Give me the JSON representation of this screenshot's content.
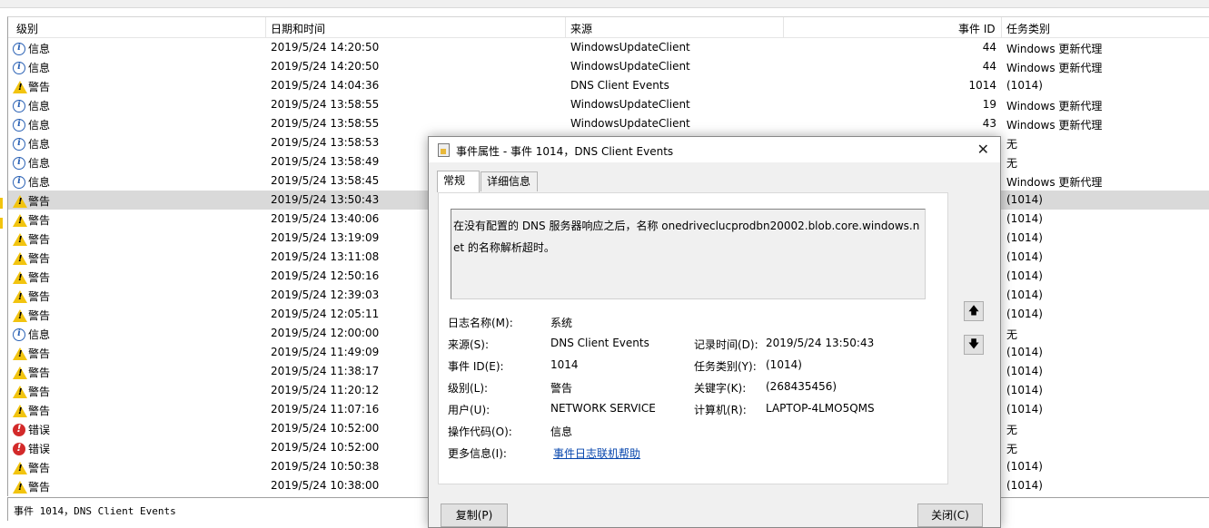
{
  "columns": {
    "level": "级别",
    "date": "日期和时间",
    "source": "来源",
    "event_id": "事件 ID",
    "task": "任务类别"
  },
  "rows": [
    {
      "icon": "info-icon",
      "level": "信息",
      "date": "2019/5/24 14:20:50",
      "source": "WindowsUpdateClient",
      "id": "44",
      "task": "Windows 更新代理"
    },
    {
      "icon": "info-icon",
      "level": "信息",
      "date": "2019/5/24 14:20:50",
      "source": "WindowsUpdateClient",
      "id": "44",
      "task": "Windows 更新代理"
    },
    {
      "icon": "warning-icon",
      "level": "警告",
      "date": "2019/5/24 14:04:36",
      "source": "DNS Client Events",
      "id": "1014",
      "task": "(1014)"
    },
    {
      "icon": "info-icon",
      "level": "信息",
      "date": "2019/5/24 13:58:55",
      "source": "WindowsUpdateClient",
      "id": "19",
      "task": "Windows 更新代理"
    },
    {
      "icon": "info-icon",
      "level": "信息",
      "date": "2019/5/24 13:58:55",
      "source": "WindowsUpdateClient",
      "id": "43",
      "task": "Windows 更新代理"
    },
    {
      "icon": "info-icon",
      "level": "信息",
      "date": "2019/5/24 13:58:53",
      "source": "",
      "id": "",
      "task": "无"
    },
    {
      "icon": "info-icon",
      "level": "信息",
      "date": "2019/5/24 13:58:49",
      "source": "",
      "id": "",
      "task": "无"
    },
    {
      "icon": "info-icon",
      "level": "信息",
      "date": "2019/5/24 13:58:45",
      "source": "",
      "id": "",
      "task": "Windows 更新代理"
    },
    {
      "icon": "warning-icon",
      "level": "警告",
      "date": "2019/5/24 13:50:43",
      "source": "",
      "id": "",
      "task": "(1014)",
      "selected": true
    },
    {
      "icon": "warning-icon",
      "level": "警告",
      "date": "2019/5/24 13:40:06",
      "source": "",
      "id": "",
      "task": "(1014)"
    },
    {
      "icon": "warning-icon",
      "level": "警告",
      "date": "2019/5/24 13:19:09",
      "source": "",
      "id": "",
      "task": "(1014)"
    },
    {
      "icon": "warning-icon",
      "level": "警告",
      "date": "2019/5/24 13:11:08",
      "source": "",
      "id": "",
      "task": "(1014)"
    },
    {
      "icon": "warning-icon",
      "level": "警告",
      "date": "2019/5/24 12:50:16",
      "source": "",
      "id": "",
      "task": "(1014)"
    },
    {
      "icon": "warning-icon",
      "level": "警告",
      "date": "2019/5/24 12:39:03",
      "source": "",
      "id": "",
      "task": "(1014)"
    },
    {
      "icon": "warning-icon",
      "level": "警告",
      "date": "2019/5/24 12:05:11",
      "source": "",
      "id": "",
      "task": "(1014)"
    },
    {
      "icon": "info-icon",
      "level": "信息",
      "date": "2019/5/24 12:00:00",
      "source": "",
      "id": "",
      "task": "无"
    },
    {
      "icon": "warning-icon",
      "level": "警告",
      "date": "2019/5/24 11:49:09",
      "source": "",
      "id": "",
      "task": "(1014)"
    },
    {
      "icon": "warning-icon",
      "level": "警告",
      "date": "2019/5/24 11:38:17",
      "source": "",
      "id": "",
      "task": "(1014)"
    },
    {
      "icon": "warning-icon",
      "level": "警告",
      "date": "2019/5/24 11:20:12",
      "source": "",
      "id": "",
      "task": "(1014)"
    },
    {
      "icon": "warning-icon",
      "level": "警告",
      "date": "2019/5/24 11:07:16",
      "source": "",
      "id": "",
      "task": "(1014)"
    },
    {
      "icon": "error-icon",
      "level": "错误",
      "date": "2019/5/24 10:52:00",
      "source": "",
      "id": "",
      "task": "无"
    },
    {
      "icon": "error-icon",
      "level": "错误",
      "date": "2019/5/24 10:52:00",
      "source": "",
      "id": "",
      "task": "无"
    },
    {
      "icon": "warning-icon",
      "level": "警告",
      "date": "2019/5/24 10:50:38",
      "source": "",
      "id": "",
      "task": "(1014)"
    },
    {
      "icon": "warning-icon",
      "level": "警告",
      "date": "2019/5/24 10:38:00",
      "source": "",
      "id": "",
      "task": "(1014)"
    }
  ],
  "status_bar": "事件 1014，DNS Client Events",
  "dialog": {
    "title": "事件属性 - 事件 1014，DNS Client Events",
    "tabs": [
      "常规",
      "详细信息"
    ],
    "description": "在没有配置的 DNS 服务器响应之后，名称 onedriveclucprodbn20002.blob.core.windows.net 的名称解析超时。",
    "labels": {
      "log_name": "日志名称(M):",
      "source": "来源(S):",
      "event_id": "事件 ID(E):",
      "level": "级别(L):",
      "user": "用户(U):",
      "opcode": "操作代码(O):",
      "more_info": "更多信息(I):",
      "logged": "记录时间(D):",
      "task": "任务类别(Y):",
      "keywords": "关键字(K):",
      "computer": "计算机(R):"
    },
    "values": {
      "log_name": "系统",
      "source": "DNS Client Events",
      "event_id": "1014",
      "level": "警告",
      "user": "NETWORK SERVICE",
      "opcode": "信息",
      "more_info": "事件日志联机帮助",
      "logged": "2019/5/24 13:50:43",
      "task": "(1014)",
      "keywords": "(268435456)",
      "computer": "LAPTOP-4LMO5QMS"
    },
    "copy_button": "复制(P)",
    "close_button": "关闭(C)"
  }
}
